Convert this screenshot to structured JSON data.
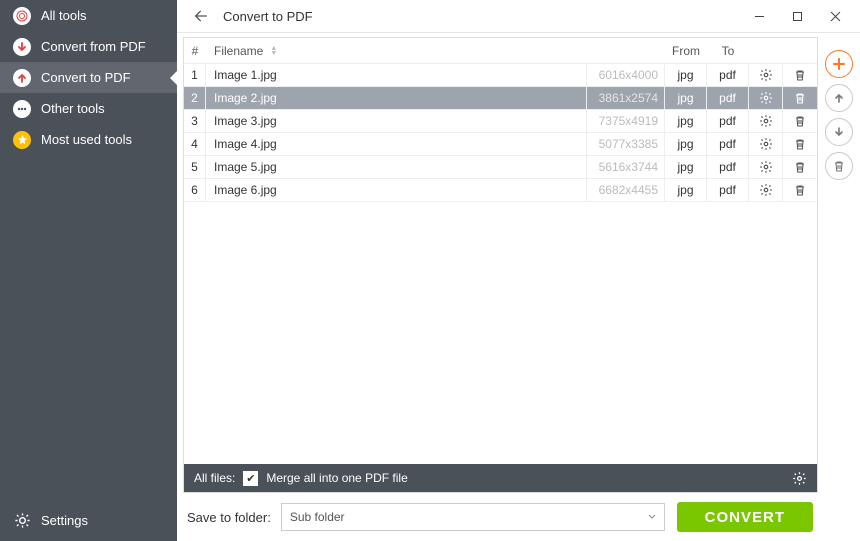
{
  "sidebar": {
    "items": [
      {
        "label": "All tools"
      },
      {
        "label": "Convert from PDF"
      },
      {
        "label": "Convert to PDF"
      },
      {
        "label": "Other tools"
      },
      {
        "label": "Most used tools"
      }
    ],
    "settings_label": "Settings"
  },
  "header": {
    "title": "Convert to PDF"
  },
  "table": {
    "headers": {
      "num": "#",
      "filename": "Filename",
      "from": "From",
      "to": "To"
    },
    "rows": [
      {
        "n": "1",
        "name": "Image 1.jpg",
        "dim": "6016x4000",
        "from": "jpg",
        "to": "pdf",
        "selected": false
      },
      {
        "n": "2",
        "name": "Image 2.jpg",
        "dim": "3861x2574",
        "from": "jpg",
        "to": "pdf",
        "selected": true
      },
      {
        "n": "3",
        "name": "Image 3.jpg",
        "dim": "7375x4919",
        "from": "jpg",
        "to": "pdf",
        "selected": false
      },
      {
        "n": "4",
        "name": "Image 4.jpg",
        "dim": "5077x3385",
        "from": "jpg",
        "to": "pdf",
        "selected": false
      },
      {
        "n": "5",
        "name": "Image 5.jpg",
        "dim": "5616x3744",
        "from": "jpg",
        "to": "pdf",
        "selected": false
      },
      {
        "n": "6",
        "name": "Image 6.jpg",
        "dim": "6682x4455",
        "from": "jpg",
        "to": "pdf",
        "selected": false
      }
    ]
  },
  "allfiles": {
    "label": "All files:",
    "merge_label": "Merge all into one PDF file",
    "merge_checked": true
  },
  "footer": {
    "save_label": "Save to folder:",
    "folder_value": "Sub folder",
    "convert_label": "CONVERT"
  }
}
